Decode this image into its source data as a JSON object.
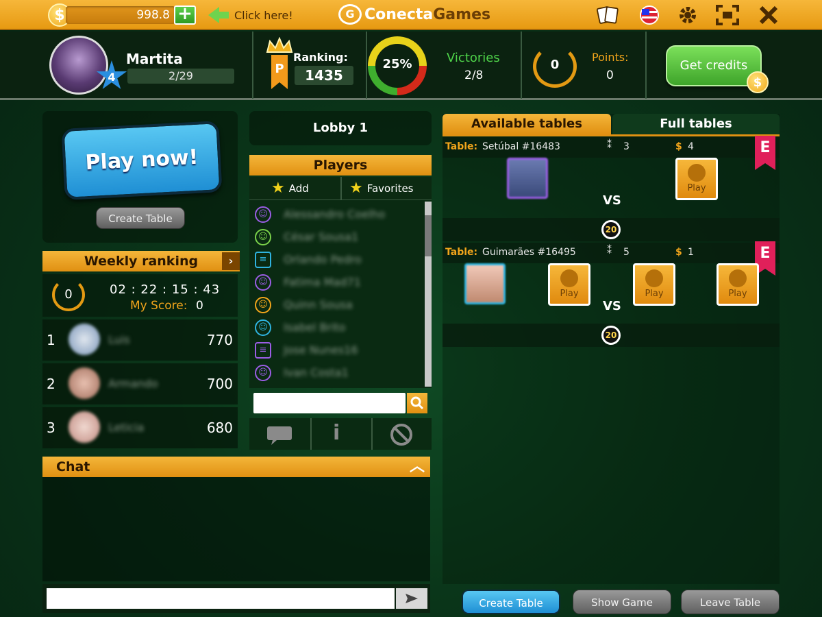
{
  "topbar": {
    "credits": "998.8",
    "click_here": "Click here!",
    "brand_a": "Conecta",
    "brand_b": "Games",
    "coin_symbol": "$",
    "plus": "+"
  },
  "player": {
    "name": "Martita",
    "level": "4",
    "progress": "2/29",
    "progress_fraction": 0.069
  },
  "ranking": {
    "label": "Ranking:",
    "value": "1435"
  },
  "donut": {
    "percent": "25%",
    "value": 0.25
  },
  "victories": {
    "label": "Victories",
    "value": "2/8"
  },
  "points": {
    "label": "Points:",
    "value": "0",
    "badge": "0"
  },
  "get_credits": {
    "label": "Get credits"
  },
  "play_now": {
    "label": "Play now!"
  },
  "create_table": {
    "label": "Create Table"
  },
  "weekly": {
    "title": "Weekly ranking",
    "countdown": "02 : 22 : 15 : 43",
    "my_score_label": "My Score:",
    "my_score": "0",
    "badge": "0",
    "rows": [
      {
        "rank": "1",
        "name": "Luis",
        "score": "770"
      },
      {
        "rank": "2",
        "name": "Armando",
        "score": "700"
      },
      {
        "rank": "3",
        "name": "Leticia",
        "score": "680"
      }
    ]
  },
  "lobby": {
    "title": "Lobby 1"
  },
  "players": {
    "title": "Players",
    "add": "Add",
    "favorites": "Favorites",
    "list": [
      "Alessandro Coelho",
      "César Sousa1",
      "Orlando Pedro",
      "Fatima Mad71",
      "Quinn Sousa",
      "Isabel Brito",
      "Jose Nunes16",
      "Ivan Costa1"
    ],
    "search_placeholder": ""
  },
  "chat": {
    "title": "Chat",
    "input_placeholder": ""
  },
  "tabs": {
    "available": "Available tables",
    "full": "Full tables"
  },
  "tables": [
    {
      "label": "Table:",
      "name": "Setúbal #16483",
      "players": "3",
      "stake": "4",
      "badge": "E",
      "timer": "20",
      "vs": "VS",
      "play": "Play"
    },
    {
      "label": "Table:",
      "name": "Guimarães #16495",
      "players": "5",
      "stake": "1",
      "badge": "E",
      "timer": "20",
      "vs": "VS",
      "play": "Play"
    }
  ],
  "bottom": {
    "create_table": "Create Table",
    "show_game": "Show Game",
    "leave_table": "Leave Table"
  },
  "colors": {
    "accent_orange": "#f2a51b",
    "green": "#4fd44a",
    "blue": "#1f8fd4",
    "bg": "#0a3519"
  }
}
